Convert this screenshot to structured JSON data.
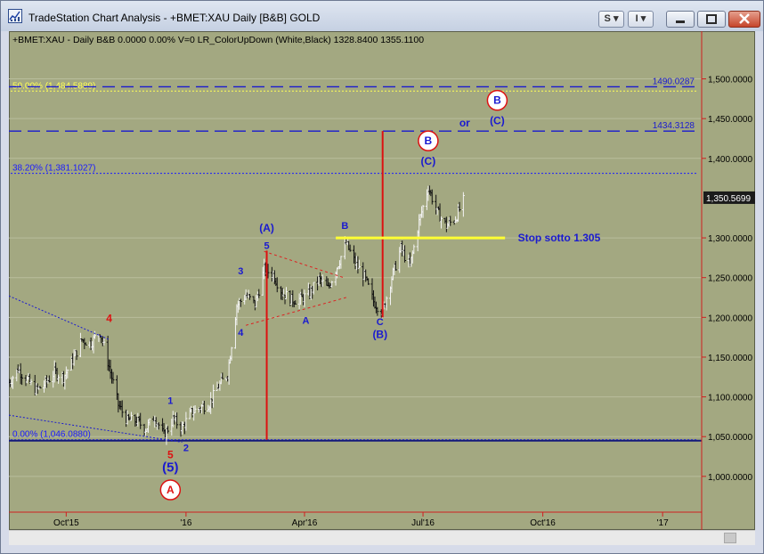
{
  "window": {
    "title": "TradeStation Chart Analysis - +BMET:XAU Daily [B&B] GOLD",
    "btn_s": "S",
    "btn_i": "I",
    "accent_close": "#c6452a"
  },
  "chart": {
    "status_line": "+BMET:XAU - Daily  B&B  0.0000  0.00%  V=0  LR_ColorUpDown (White,Black)   1328.8400  1355.1100",
    "bg_color": "#a3a881",
    "y_ticks": [
      "1,500.0000",
      "1,450.0000",
      "1,400.0000",
      "1,300.0000",
      "1,250.0000",
      "1,200.0000",
      "1,150.0000",
      "1,100.0000",
      "1,050.0000",
      "1,000.0000"
    ],
    "y_tick_values": [
      1500,
      1450,
      1400,
      1300,
      1250,
      1200,
      1150,
      1100,
      1050,
      1000
    ],
    "x_ticks": [
      "Oct'15",
      "'16",
      "Apr'16",
      "Jul'16",
      "Oct'16",
      "'17"
    ],
    "x_tick_dates": [
      "2015-10-01",
      "2016-01-01",
      "2016-04-01",
      "2016-07-01",
      "2016-10-01",
      "2017-01-01"
    ],
    "last_price_label": "1,350.5699",
    "last_price": 1350.57,
    "fib_levels": [
      {
        "label": "50.00% (1,484.5889)",
        "value": 1484.5889,
        "color": "#ffff55"
      },
      {
        "label": "38.20% (1,381.1027)",
        "value": 1381.1027,
        "color": "#1a1aff"
      },
      {
        "label": "0.00% (1,046.0880)",
        "value": 1046.088,
        "color": "#1a1aff"
      }
    ],
    "target_levels": [
      {
        "label": "1490.0287",
        "value": 1490.0287
      },
      {
        "label": "1434.3128",
        "value": 1434.3128
      }
    ],
    "support_line": {
      "label": "Stop sotto 1.305",
      "value": 1300
    },
    "labels": {
      "or": "or",
      "wave_C_paren": "(C)",
      "wave_A_paren": "(A)",
      "wave_B_paren": "(B)",
      "wave_5_paren": "(5)",
      "B": "B",
      "A": "A",
      "C": "C",
      "n1": "1",
      "n2": "2",
      "n3": "3",
      "n4": "4",
      "n5": "5"
    }
  },
  "chart_data": {
    "type": "bar",
    "title": "",
    "series_name": "+BMET:XAU Daily",
    "ylim": [
      955,
      1560
    ],
    "x_range": [
      "2015-08-18",
      "2017-01-31"
    ],
    "closes": [
      [
        "2015-08-18",
        1118
      ],
      [
        "2015-08-25",
        1135
      ],
      [
        "2015-09-01",
        1121
      ],
      [
        "2015-09-08",
        1108
      ],
      [
        "2015-09-15",
        1117
      ],
      [
        "2015-09-22",
        1131
      ],
      [
        "2015-09-29",
        1125
      ],
      [
        "2015-10-06",
        1146
      ],
      [
        "2015-10-13",
        1172
      ],
      [
        "2015-10-20",
        1168
      ],
      [
        "2015-10-27",
        1182
      ],
      [
        "2015-11-03",
        1138
      ],
      [
        "2015-11-10",
        1090
      ],
      [
        "2015-11-17",
        1070
      ],
      [
        "2015-11-24",
        1070
      ],
      [
        "2015-12-01",
        1060
      ],
      [
        "2015-12-08",
        1075
      ],
      [
        "2015-12-15",
        1051
      ],
      [
        "2015-12-22",
        1072
      ],
      [
        "2015-12-29",
        1061
      ],
      [
        "2016-01-05",
        1080
      ],
      [
        "2016-01-12",
        1087
      ],
      [
        "2016-01-19",
        1092
      ],
      [
        "2016-01-26",
        1113
      ],
      [
        "2016-02-02",
        1130
      ],
      [
        "2016-02-09",
        1215
      ],
      [
        "2016-02-16",
        1228
      ],
      [
        "2016-02-23",
        1216
      ],
      [
        "2016-03-01",
        1260
      ],
      [
        "2016-03-08",
        1254
      ],
      [
        "2016-03-15",
        1231
      ],
      [
        "2016-03-22",
        1222
      ],
      [
        "2016-03-29",
        1223
      ],
      [
        "2016-04-05",
        1230
      ],
      [
        "2016-04-12",
        1248
      ],
      [
        "2016-04-19",
        1236
      ],
      [
        "2016-04-26",
        1264
      ],
      [
        "2016-05-03",
        1293
      ],
      [
        "2016-05-10",
        1268
      ],
      [
        "2016-05-17",
        1251
      ],
      [
        "2016-05-24",
        1220
      ],
      [
        "2016-05-31",
        1207
      ],
      [
        "2016-06-07",
        1250
      ],
      [
        "2016-06-14",
        1287
      ],
      [
        "2016-06-21",
        1264
      ],
      [
        "2016-06-28",
        1320
      ],
      [
        "2016-07-05",
        1364
      ],
      [
        "2016-07-12",
        1332
      ],
      [
        "2016-07-19",
        1315
      ],
      [
        "2016-07-26",
        1325
      ],
      [
        "2016-08-02",
        1350
      ]
    ],
    "lows_marked": [
      [
        "2015-12-17",
        1046.088
      ]
    ],
    "vertical_lines": [
      {
        "date": "2016-03-03",
        "from": 1046.088,
        "to": 1284
      },
      {
        "date": "2016-05-31",
        "from": 1200,
        "to": 1434.3128
      }
    ]
  }
}
